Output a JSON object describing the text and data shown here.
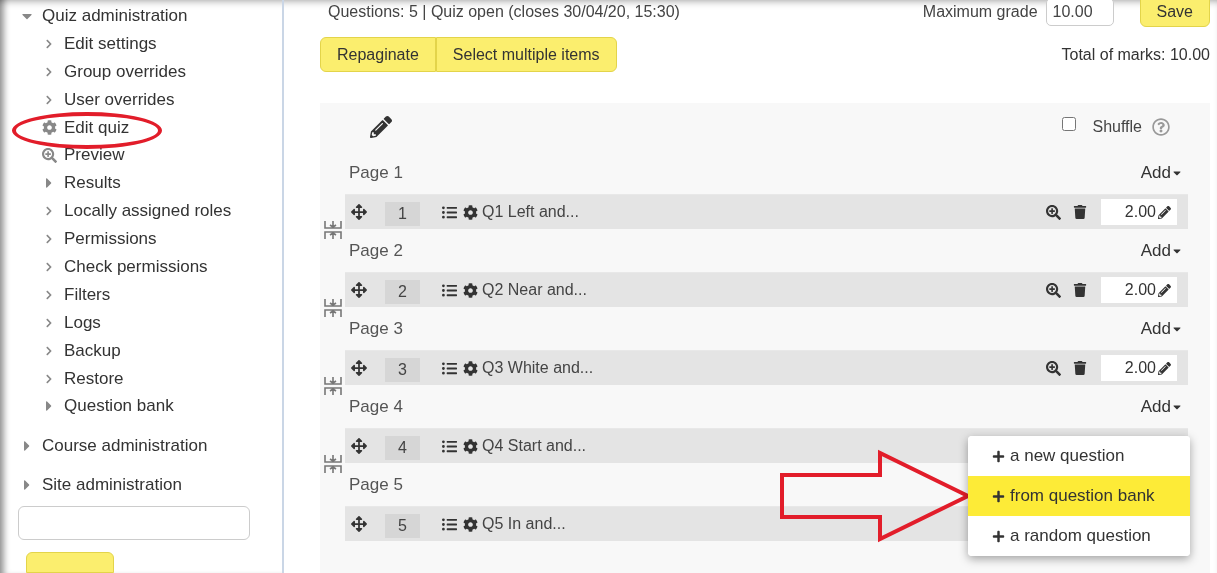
{
  "sidebar": {
    "title": "Quiz administration",
    "expanded": true,
    "items": [
      {
        "label": "Edit settings",
        "kind": "link"
      },
      {
        "label": "Group overrides",
        "kind": "link"
      },
      {
        "label": "User overrides",
        "kind": "link"
      },
      {
        "label": "Edit quiz",
        "kind": "gear"
      },
      {
        "label": "Preview",
        "kind": "preview"
      },
      {
        "label": "Results",
        "kind": "branch"
      },
      {
        "label": "Locally assigned roles",
        "kind": "link"
      },
      {
        "label": "Permissions",
        "kind": "link"
      },
      {
        "label": "Check permissions",
        "kind": "link"
      },
      {
        "label": "Filters",
        "kind": "link"
      },
      {
        "label": "Logs",
        "kind": "link"
      },
      {
        "label": "Backup",
        "kind": "link"
      },
      {
        "label": "Restore",
        "kind": "link"
      },
      {
        "label": "Question bank",
        "kind": "branch"
      }
    ],
    "sections": [
      {
        "label": "Course administration",
        "expanded": false
      },
      {
        "label": "Site administration",
        "expanded": false
      }
    ]
  },
  "header": {
    "status": "Questions: 5 | Quiz open (closes 30/04/20, 15:30)",
    "max_grade_label": "Maximum grade",
    "max_grade": "10.00",
    "save": "Save"
  },
  "toolbar": {
    "buttons": [
      "Repaginate",
      "Select multiple items"
    ],
    "total": "Total of marks: 10.00"
  },
  "panel": {
    "shuffle": {
      "label": "Shuffle",
      "checked": false
    },
    "pages": [
      {
        "label": "Page 1",
        "add": "Add",
        "question": {
          "number": "1",
          "title": "Q1 Left and...",
          "mark": "2.00"
        }
      },
      {
        "label": "Page 2",
        "add": "Add",
        "question": {
          "number": "2",
          "title": "Q2 Near and...",
          "mark": "2.00"
        }
      },
      {
        "label": "Page 3",
        "add": "Add",
        "question": {
          "number": "3",
          "title": "Q3 White and...",
          "mark": "2.00"
        }
      },
      {
        "label": "Page 4",
        "add": "Add",
        "question": {
          "number": "4",
          "title": "Q4 Start and..."
        }
      },
      {
        "label": "Page 5",
        "question": {
          "number": "5",
          "title": "Q5 In and..."
        }
      }
    ]
  },
  "menu": {
    "items": [
      {
        "label": "a new question",
        "selected": false
      },
      {
        "label": "from question bank",
        "selected": true
      },
      {
        "label": "a random question",
        "selected": false
      }
    ]
  }
}
